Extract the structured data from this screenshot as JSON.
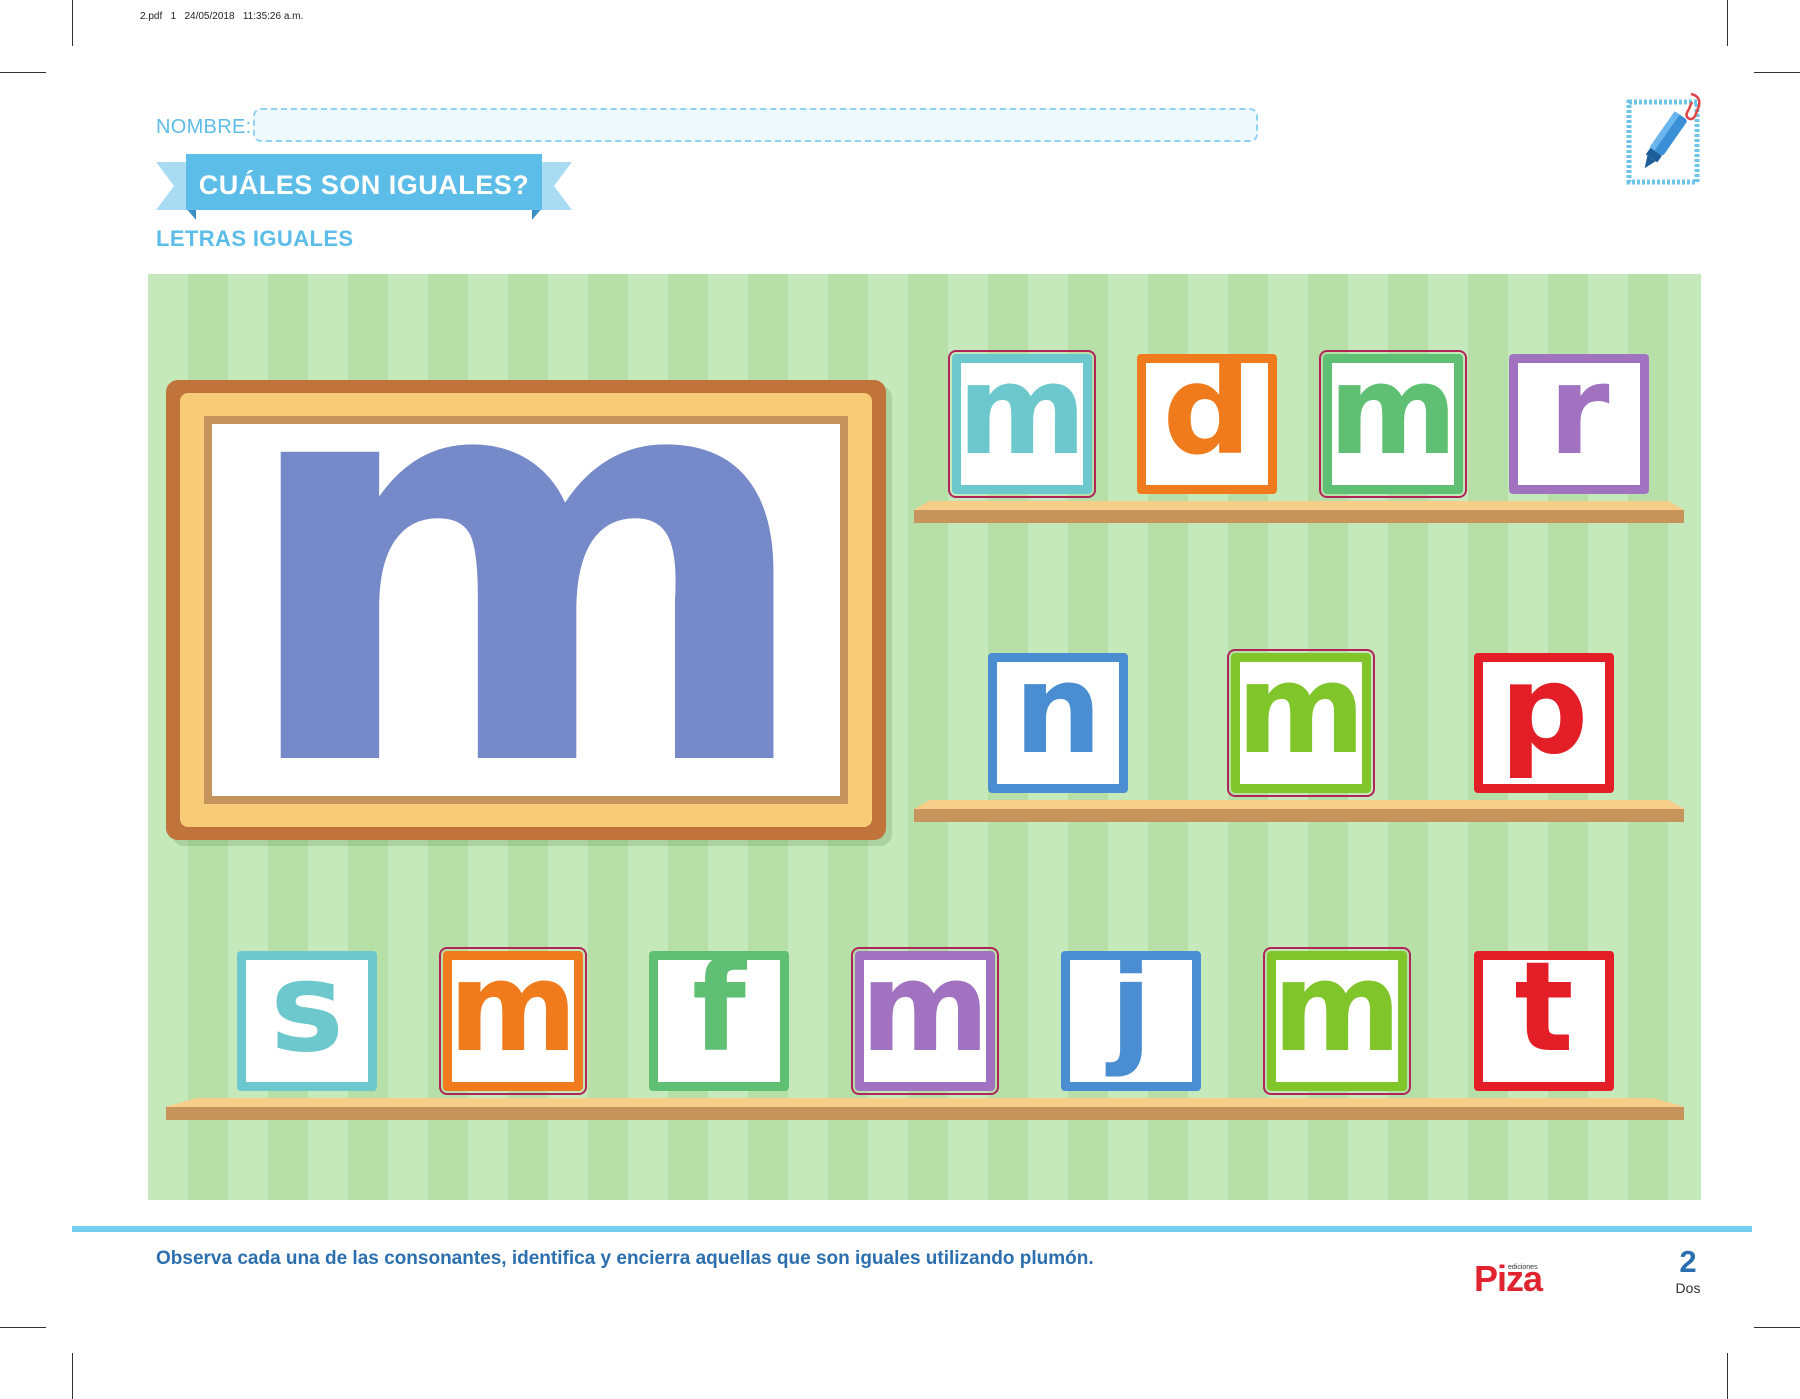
{
  "print_info": "2.pdf   1   24/05/2018   11:35:26 a.m.",
  "header": {
    "name_label": "NOMBRE:",
    "name_value": "",
    "title": "CUÁLES SON IGUALES?",
    "subtitle": "LETRAS IGUALES"
  },
  "model_letter": "m",
  "shelves": {
    "top": [
      {
        "letter": "m",
        "color": "#6cc8cc",
        "circled": true
      },
      {
        "letter": "d",
        "color": "#f07b1c",
        "circled": false
      },
      {
        "letter": "m",
        "color": "#5fbf72",
        "circled": true
      },
      {
        "letter": "r",
        "color": "#a072bf",
        "circled": false
      }
    ],
    "middle": [
      {
        "letter": "n",
        "color": "#4a8ed1",
        "circled": false
      },
      {
        "letter": "m",
        "color": "#80c52a",
        "circled": true
      },
      {
        "letter": "p",
        "color": "#e41e26",
        "circled": false
      }
    ],
    "bottom": [
      {
        "letter": "s",
        "color": "#6cc8cc",
        "circled": false
      },
      {
        "letter": "m",
        "color": "#f07b1c",
        "circled": true
      },
      {
        "letter": "f",
        "color": "#5fbf72",
        "circled": false
      },
      {
        "letter": "m",
        "color": "#a072bf",
        "circled": true
      },
      {
        "letter": "j",
        "color": "#4a8ed1",
        "circled": false
      },
      {
        "letter": "m",
        "color": "#80c52a",
        "circled": true
      },
      {
        "letter": "t",
        "color": "#e41e26",
        "circled": false
      }
    ]
  },
  "footer": {
    "instruction": "Observa cada una de las consonantes, identifica y encierra aquellas que son iguales utilizando plumón.",
    "publisher_small": "ediciones",
    "publisher": "Piza",
    "page_number": "2",
    "page_word": "Dos"
  },
  "colors": {
    "accent_blue": "#5cbde8",
    "highlight_circle": "#b0245a",
    "model_letter": "#7689c8"
  },
  "icons": [
    "marker-pen-icon",
    "paperclip-icon"
  ]
}
